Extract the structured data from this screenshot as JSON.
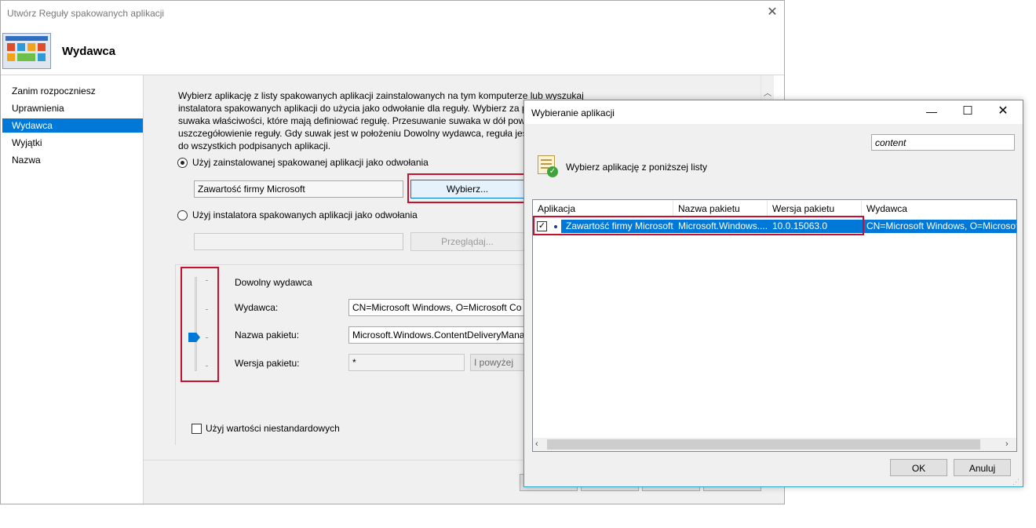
{
  "wizard": {
    "window_title": "Utwórz Reguły spakowanych aplikacji",
    "header_title": "Wydawca",
    "nav": [
      {
        "label": "Zanim rozpoczniesz"
      },
      {
        "label": "Uprawnienia"
      },
      {
        "label": "Wydawca",
        "selected": true
      },
      {
        "label": "Wyjątki"
      },
      {
        "label": "Nazwa"
      }
    ],
    "description": [
      "Wybierz aplikację z listy spakowanych aplikacji zainstalowanych na tym komputerze lub wyszukaj",
      "instalatora spakowanych aplikacji do użycia jako odwołanie dla reguły. Wybierz za po",
      "suwaka właściwości, które mają definiować regułę. Przesuwanie suwaka w dół powo",
      "uszczegółowienie reguły. Gdy suwak jest w położeniu Dowolny wydawca, reguła jest",
      "do wszystkich podpisanych aplikacji."
    ],
    "radio_installed": {
      "label": "Użyj zainstalowanej spakowanej aplikacji jako odwołania",
      "selected": true
    },
    "installed_value": "Zawartość firmy Microsoft",
    "select_button": "Wybierz...",
    "radio_installer": {
      "label": "Użyj instalatora spakowanych aplikacji jako odwołania",
      "selected": false
    },
    "installer_value": "",
    "browse_button": "Przeglądaj...",
    "slider_title": "Dowolny wydawca",
    "publisher_label": "Wydawca:",
    "publisher_value": "CN=Microsoft Windows, O=Microsoft Co",
    "package_name_label": "Nazwa pakietu:",
    "package_name_value": "Microsoft.Windows.ContentDeliveryMana",
    "package_version_label": "Wersja pakietu:",
    "package_version_value": "*",
    "version_mode": "I powyżej",
    "custom_values_label": "Użyj wartości niestandardowych"
  },
  "dialog": {
    "title": "Wybieranie aplikacji",
    "search_value": "content",
    "instruction": "Wybierz aplikację z poniższej listy",
    "columns": [
      "Aplikacja",
      "Nazwa pakietu",
      "Wersja pakietu",
      "Wydawca"
    ],
    "rows": [
      {
        "app": "Zawartość firmy Microsoft",
        "package_name": "Microsoft.Windows....",
        "version": "10.0.15063.0",
        "publisher": "CN=Microsoft Windows, O=Microsoft Co",
        "checked": true
      }
    ],
    "ok_button": "OK",
    "cancel_button": "Anuluj"
  },
  "colors": {
    "selection": "#0078d7",
    "highlight_border": "#c8102e",
    "dialog_border": "#2aa7c9"
  }
}
